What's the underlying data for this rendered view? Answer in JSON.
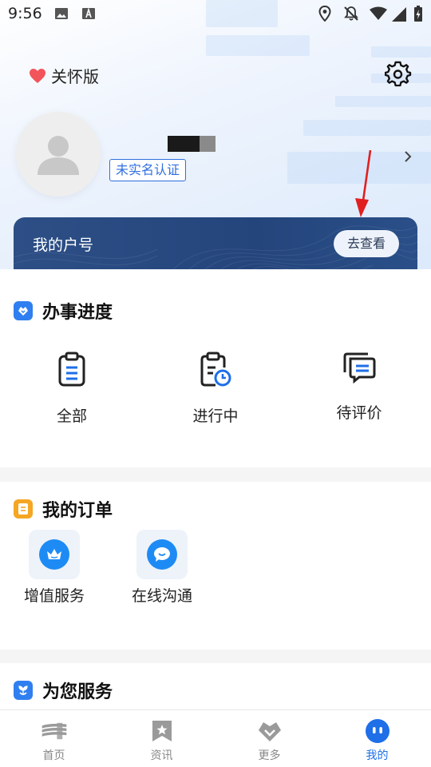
{
  "status_bar": {
    "time": "9:56"
  },
  "header": {
    "care_mode_label": "关怀版"
  },
  "profile": {
    "verify_badge": "未实名认证"
  },
  "account_card": {
    "label": "我的户号",
    "button": "去查看"
  },
  "progress": {
    "title": "办事进度",
    "items": [
      {
        "label": "全部",
        "icon": "clipboard-list-icon"
      },
      {
        "label": "进行中",
        "icon": "clipboard-clock-icon"
      },
      {
        "label": "待评价",
        "icon": "message-stack-icon"
      }
    ]
  },
  "orders": {
    "title": "我的订单",
    "items": [
      {
        "label": "增值服务",
        "icon": "crown-icon"
      },
      {
        "label": "在线沟通",
        "icon": "chat-smile-icon"
      }
    ]
  },
  "services": {
    "title": "为您服务"
  },
  "tabbar": {
    "items": [
      {
        "label": "首页"
      },
      {
        "label": "资讯"
      },
      {
        "label": "更多"
      },
      {
        "label": "我的"
      }
    ],
    "active": "我的"
  },
  "colors": {
    "accent": "#1e6fe8",
    "badge_blue": "#2f6fe0",
    "card_navy": "#24457c",
    "annotation_red": "#e02020"
  }
}
